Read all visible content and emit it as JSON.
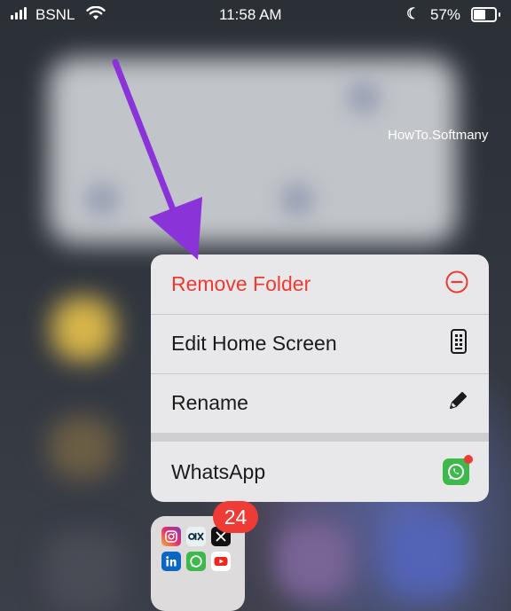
{
  "status_bar": {
    "carrier": "BSNL",
    "time": "11:58 AM",
    "battery_percent": "57%",
    "battery_level": 0.57,
    "icons": [
      "signal-icon",
      "wifi-icon",
      "moon-icon",
      "battery-icon"
    ]
  },
  "watermark": "HowTo.Softmany",
  "context_menu": {
    "items": [
      {
        "label": "Remove Folder",
        "icon": "remove-circle-icon",
        "color": "#ee3a31"
      },
      {
        "label": "Edit Home Screen",
        "icon": "phone-screen-icon"
      },
      {
        "label": "Rename",
        "icon": "pencil-icon"
      },
      {
        "label": "WhatsApp",
        "icon": "whatsapp-icon"
      }
    ]
  },
  "folder": {
    "badge": "24",
    "apps": [
      "instagram-icon",
      "olx-icon",
      "x-icon",
      "linkedin-icon",
      "whatsapp-icon",
      "youtube-icon"
    ]
  },
  "colors": {
    "destructive": "#ee3a31",
    "arrow": "#8a33d9",
    "badge": "#ef3b35",
    "whatsapp": "#3db84b"
  }
}
